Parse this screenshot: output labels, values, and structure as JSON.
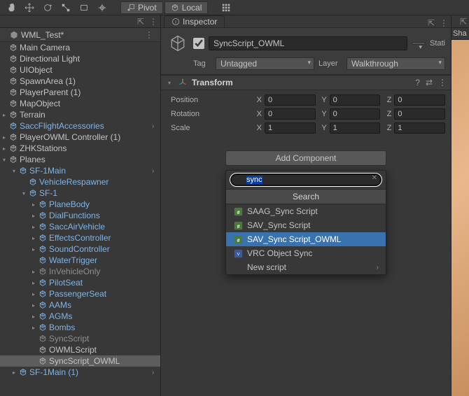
{
  "toolbar": {
    "pan_tip": "Hand",
    "move_tip": "Move",
    "rotate_tip": "Rotate",
    "scale_tip": "Scale",
    "rect_tip": "Rect",
    "multi_tip": "Transform",
    "pivot_label": "Pivot",
    "local_label": "Local"
  },
  "hierarchy": {
    "scene_title": "WML_Test*",
    "items": [
      {
        "label": "Main Camera",
        "depth": 0,
        "pad": 0,
        "arrow": "none",
        "color": "normal"
      },
      {
        "label": "Directional Light",
        "depth": 0,
        "pad": 0,
        "arrow": "none",
        "color": "normal"
      },
      {
        "label": "UIObject",
        "depth": 0,
        "pad": 0,
        "arrow": "none",
        "color": "normal"
      },
      {
        "label": "SpawnArea (1)",
        "depth": 0,
        "pad": 0,
        "arrow": "none",
        "color": "normal"
      },
      {
        "label": "PlayerParent (1)",
        "depth": 0,
        "pad": 0,
        "arrow": "none",
        "color": "normal"
      },
      {
        "label": "MapObject",
        "depth": 0,
        "pad": 0,
        "arrow": "none",
        "color": "normal"
      },
      {
        "label": "Terrain",
        "depth": 0,
        "pad": 0,
        "arrow": "right",
        "color": "normal"
      },
      {
        "label": "SaccFlightAccessories",
        "depth": 0,
        "pad": 0,
        "arrow": "none",
        "color": "prefab",
        "icon": "prefab",
        "override": true
      },
      {
        "label": "PlayerOWML Controller (1)",
        "depth": 0,
        "pad": 0,
        "arrow": "right",
        "color": "normal"
      },
      {
        "label": "ZHKStations",
        "depth": 0,
        "pad": 0,
        "arrow": "right",
        "color": "normal"
      },
      {
        "label": "Planes",
        "depth": 0,
        "pad": 0,
        "arrow": "down",
        "color": "normal",
        "icon": "prefab"
      },
      {
        "label": "SF-1Main",
        "depth": 1,
        "pad": 14,
        "arrow": "down",
        "color": "prefab",
        "icon": "prefab",
        "override": true
      },
      {
        "label": "VehicleRespawner",
        "depth": 2,
        "pad": 28,
        "arrow": "none",
        "color": "prefab",
        "icon": "prefab"
      },
      {
        "label": "SF-1",
        "depth": 2,
        "pad": 28,
        "arrow": "down",
        "color": "prefab",
        "icon": "prefab"
      },
      {
        "label": "PlaneBody",
        "depth": 3,
        "pad": 42,
        "arrow": "right",
        "color": "prefab",
        "icon": "prefab"
      },
      {
        "label": "DialFunctions",
        "depth": 3,
        "pad": 42,
        "arrow": "right",
        "color": "prefab",
        "icon": "prefab"
      },
      {
        "label": "SaccAirVehicle",
        "depth": 3,
        "pad": 42,
        "arrow": "right",
        "color": "prefab",
        "icon": "prefab"
      },
      {
        "label": "EffectsController",
        "depth": 3,
        "pad": 42,
        "arrow": "right",
        "color": "prefab",
        "icon": "prefab"
      },
      {
        "label": "SoundController",
        "depth": 3,
        "pad": 42,
        "arrow": "right",
        "color": "prefab",
        "icon": "prefab"
      },
      {
        "label": "WaterTrigger",
        "depth": 3,
        "pad": 42,
        "arrow": "none",
        "color": "prefab",
        "icon": "prefab"
      },
      {
        "label": "InVehicleOnly",
        "depth": 3,
        "pad": 42,
        "arrow": "right",
        "color": "muted",
        "icon": "prefab"
      },
      {
        "label": "PilotSeat",
        "depth": 3,
        "pad": 42,
        "arrow": "right",
        "color": "prefab",
        "icon": "prefab"
      },
      {
        "label": "PassengerSeat",
        "depth": 3,
        "pad": 42,
        "arrow": "right",
        "color": "prefab",
        "icon": "prefab"
      },
      {
        "label": "AAMs",
        "depth": 3,
        "pad": 42,
        "arrow": "right",
        "color": "prefab",
        "icon": "prefab"
      },
      {
        "label": "AGMs",
        "depth": 3,
        "pad": 42,
        "arrow": "right",
        "color": "prefab",
        "icon": "prefab"
      },
      {
        "label": "Bombs",
        "depth": 3,
        "pad": 42,
        "arrow": "right",
        "color": "prefab",
        "icon": "prefab"
      },
      {
        "label": "SyncScript",
        "depth": 3,
        "pad": 42,
        "arrow": "none",
        "color": "muted",
        "icon": "prefab-light"
      },
      {
        "label": "OWMLScript",
        "depth": 3,
        "pad": 42,
        "arrow": "none",
        "color": "normal",
        "icon": "prefab-light"
      },
      {
        "label": "SyncScript_OWML",
        "depth": 3,
        "pad": 42,
        "arrow": "none",
        "color": "normal",
        "icon": "prefab-light",
        "selected": true
      },
      {
        "label": "SF-1Main (1)",
        "depth": 1,
        "pad": 14,
        "arrow": "right",
        "color": "prefab",
        "icon": "prefab",
        "override": true
      }
    ]
  },
  "inspector": {
    "tab_title": "Inspector",
    "active": true,
    "object_name": "SyncScript_OWML",
    "static_label": "Stati",
    "tag_field": "Tag",
    "tag_value": "Untagged",
    "layer_field": "Layer",
    "layer_value": "Walkthrough",
    "transform": {
      "title": "Transform",
      "rows": [
        {
          "label": "Position",
          "x": "0",
          "y": "0",
          "z": "0"
        },
        {
          "label": "Rotation",
          "x": "0",
          "y": "0",
          "z": "0"
        },
        {
          "label": "Scale",
          "x": "1",
          "y": "1",
          "z": "1"
        }
      ],
      "xlabel": "X",
      "ylabel": "Y",
      "zlabel": "Z"
    },
    "add_component_label": "Add Component",
    "search": {
      "query": "sync",
      "title": "Search",
      "items": [
        {
          "label": "SAAG_Sync Script",
          "icon": "cs"
        },
        {
          "label": "SAV_Sync Script",
          "icon": "cs"
        },
        {
          "label": "SAV_Sync Script_OWML",
          "icon": "cs",
          "highlighted": true
        },
        {
          "label": "VRC Object Sync",
          "icon": "vrc"
        },
        {
          "label": "New script",
          "icon": "none",
          "chevron": true
        }
      ]
    }
  },
  "right_panel": {
    "tab": "Sha"
  }
}
